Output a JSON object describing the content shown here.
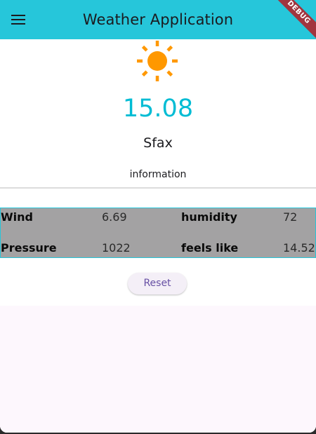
{
  "appbar": {
    "title": "Weather Application",
    "debug_label": "DEBUG",
    "background": "#26c6da"
  },
  "weather": {
    "icon": "sun-icon",
    "temperature": "15.08",
    "city": "Sfax",
    "section_title": "information"
  },
  "details": {
    "wind_label": "Wind",
    "wind_value": "6.69",
    "humidity_label": "humidity",
    "humidity_value": "72",
    "pressure_label": "Pressure",
    "pressure_value": "1022",
    "feels_like_label": "feels like",
    "feels_like_value": "14.52"
  },
  "actions": {
    "reset_label": "Reset"
  },
  "colors": {
    "accent": "#00bcd4",
    "sun": "#ff9800",
    "button_text": "#6750a4"
  }
}
